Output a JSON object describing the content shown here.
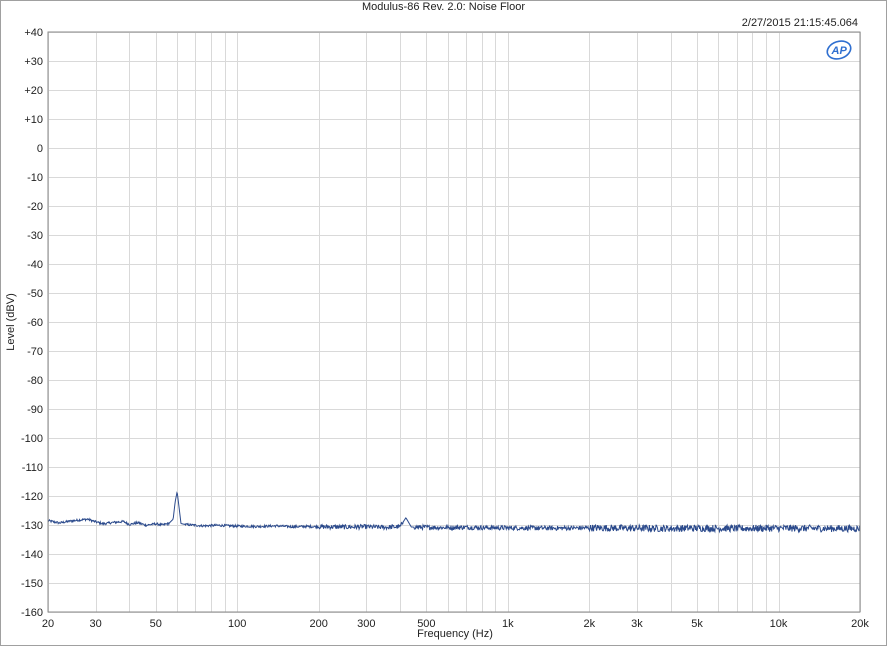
{
  "chart_data": {
    "type": "line",
    "title": "Modulus-86 Rev. 2.0: Noise Floor",
    "timestamp": "2/27/2015 21:15:45.064",
    "xlabel": "Frequency (Hz)",
    "ylabel": "Level (dBV)",
    "x_scale": "log",
    "xlim": [
      20,
      20000
    ],
    "ylim": [
      -160,
      40
    ],
    "grid": true,
    "logo": "ap-logo",
    "x_ticks": [
      {
        "value": 20,
        "label": "20"
      },
      {
        "value": 30,
        "label": "30"
      },
      {
        "value": 50,
        "label": "50"
      },
      {
        "value": 100,
        "label": "100"
      },
      {
        "value": 200,
        "label": "200"
      },
      {
        "value": 300,
        "label": "300"
      },
      {
        "value": 500,
        "label": "500"
      },
      {
        "value": 1000,
        "label": "1k"
      },
      {
        "value": 2000,
        "label": "2k"
      },
      {
        "value": 3000,
        "label": "3k"
      },
      {
        "value": 5000,
        "label": "5k"
      },
      {
        "value": 10000,
        "label": "10k"
      },
      {
        "value": 20000,
        "label": "20k"
      }
    ],
    "y_ticks": [
      {
        "value": 40,
        "label": "+40"
      },
      {
        "value": 30,
        "label": "+30"
      },
      {
        "value": 20,
        "label": "+20"
      },
      {
        "value": 10,
        "label": "+10"
      },
      {
        "value": 0,
        "label": "0"
      },
      {
        "value": -10,
        "label": "-10"
      },
      {
        "value": -20,
        "label": "-20"
      },
      {
        "value": -30,
        "label": "-30"
      },
      {
        "value": -40,
        "label": "-40"
      },
      {
        "value": -50,
        "label": "-50"
      },
      {
        "value": -60,
        "label": "-60"
      },
      {
        "value": -70,
        "label": "-70"
      },
      {
        "value": -80,
        "label": "-80"
      },
      {
        "value": -90,
        "label": "-90"
      },
      {
        "value": -100,
        "label": "-100"
      },
      {
        "value": -110,
        "label": "-110"
      },
      {
        "value": -120,
        "label": "-120"
      },
      {
        "value": -130,
        "label": "-130"
      },
      {
        "value": -140,
        "label": "-140"
      },
      {
        "value": -150,
        "label": "-150"
      },
      {
        "value": -160,
        "label": "-160"
      }
    ],
    "series": [
      {
        "color": "#2b4a8c",
        "x": [
          20,
          22,
          24,
          26,
          28,
          30,
          32,
          35,
          38,
          40,
          43,
          46,
          50,
          53,
          56,
          58,
          59,
          60,
          61,
          62,
          64,
          68,
          75,
          85,
          100,
          120,
          140,
          160,
          180,
          200,
          250,
          300,
          350,
          400,
          420,
          440,
          500,
          600,
          700,
          800,
          1000,
          1500,
          2000,
          3000,
          4000,
          5000,
          7000,
          10000,
          15000,
          20000
        ],
        "y": [
          -128.5,
          -129.3,
          -128.7,
          -128.3,
          -128.0,
          -128.9,
          -129.6,
          -129.1,
          -128.8,
          -129.8,
          -129.2,
          -130.1,
          -129.6,
          -130.0,
          -129.4,
          -128.0,
          -122.0,
          -118.5,
          -124.0,
          -129.5,
          -129.8,
          -130.0,
          -130.3,
          -130.1,
          -130.4,
          -130.5,
          -130.3,
          -130.6,
          -130.5,
          -130.6,
          -130.7,
          -130.6,
          -130.8,
          -130.6,
          -127.5,
          -130.7,
          -130.8,
          -130.9,
          -130.8,
          -130.9,
          -131.0,
          -131.1,
          -131.0,
          -131.1,
          -131.2,
          -131.1,
          -131.2,
          -131.1,
          -131.2,
          -131.2
        ],
        "noise_band_db": [
          {
            "from": 20,
            "to": 200,
            "spread": 0.8
          },
          {
            "from": 200,
            "to": 2000,
            "spread": 1.6
          },
          {
            "from": 2000,
            "to": 20000,
            "spread": 2.4
          }
        ]
      }
    ]
  }
}
